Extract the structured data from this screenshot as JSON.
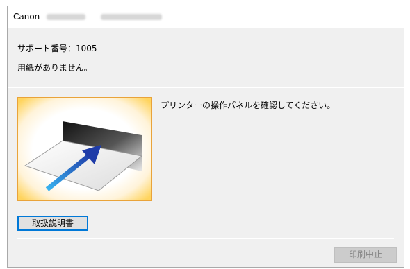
{
  "window": {
    "title": "Canon",
    "title_separator": "-"
  },
  "content": {
    "support_code_line": "サポート番号：1005",
    "message": "用紙がありません。",
    "instruction": "プリンターの操作パネルを確認してください。"
  },
  "buttons": {
    "manual_label": "取扱説明書",
    "cancel_print_label": "印刷中止"
  },
  "illustration": {
    "icon": "paper-feed-illustration",
    "accent_colors": {
      "glow": "#ffd45e",
      "border": "#e9a33a",
      "arrow_start": "#39b4f0",
      "arrow_end": "#1f3ca8"
    }
  },
  "colors": {
    "window_bg": "#f0f0f0",
    "button_focus_border": "#0078d7",
    "disabled_text": "#838383"
  }
}
